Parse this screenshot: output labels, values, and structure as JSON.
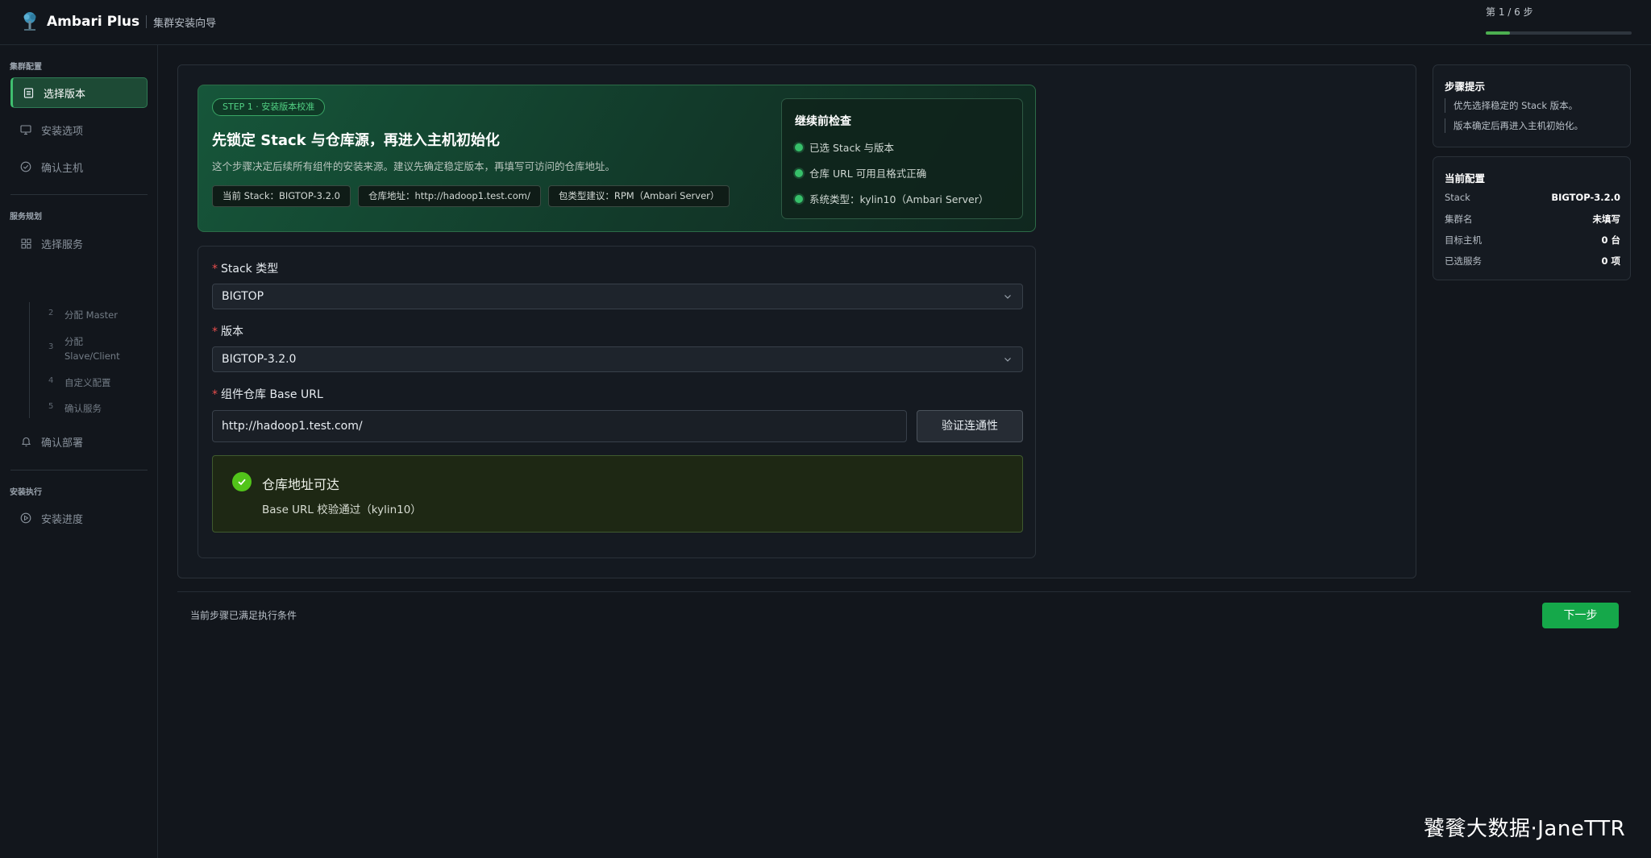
{
  "header": {
    "app_name": "Ambari Plus",
    "subtitle": "集群安装向导",
    "step_text": "第 1 / 6 步",
    "progress_fraction": 0.1667
  },
  "sidebar": {
    "sections": [
      {
        "title": "集群配置"
      },
      {
        "title": "服务规划"
      },
      {
        "title": "安装执行"
      }
    ],
    "items": [
      {
        "label": "选择版本",
        "icon": "list-icon",
        "active": true
      },
      {
        "label": "安装选项",
        "icon": "monitor-icon",
        "active": false
      },
      {
        "label": "确认主机",
        "icon": "check-circle-icon",
        "active": false
      },
      {
        "label": "选择服务",
        "icon": "grid-icon",
        "active": false
      },
      {
        "label": "确认部署",
        "icon": "bell-icon",
        "active": false
      },
      {
        "label": "安装进度",
        "icon": "play-circle-icon",
        "active": false
      }
    ],
    "sub_items": [
      {
        "num": "2",
        "label": "分配 Master"
      },
      {
        "num": "3",
        "label": "分配 Slave/Client"
      },
      {
        "num": "4",
        "label": "自定义配置"
      },
      {
        "num": "5",
        "label": "确认服务"
      }
    ]
  },
  "hero": {
    "badge": "STEP 1 · 安装版本校准",
    "title": "先锁定 Stack 与仓库源，再进入主机初始化",
    "description": "这个步骤决定后续所有组件的安装来源。建议先确定稳定版本，再填写可访问的仓库地址。",
    "chips": [
      "当前 Stack：BIGTOP-3.2.0",
      "仓库地址：http://hadoop1.test.com/",
      "包类型建议：RPM（Ambari Server）"
    ],
    "precheck": {
      "title": "继续前检查",
      "items": [
        "已选 Stack 与版本",
        "仓库 URL 可用且格式正确",
        "系统类型：kylin10（Ambari Server）"
      ]
    }
  },
  "form": {
    "stack_label": "Stack 类型",
    "stack_value": "BIGTOP",
    "version_label": "版本",
    "version_value": "BIGTOP-3.2.0",
    "url_label": "组件仓库 Base URL",
    "url_value": "http://hadoop1.test.com/",
    "verify_label": "验证连通性",
    "success_title": "仓库地址可达",
    "success_desc": "Base URL 校验通过（kylin10）"
  },
  "tips": {
    "title": "步骤提示",
    "items": [
      "优先选择稳定的 Stack 版本。",
      "版本确定后再进入主机初始化。"
    ]
  },
  "config": {
    "title": "当前配置",
    "rows": [
      {
        "key": "Stack",
        "value": "BIGTOP-3.2.0"
      },
      {
        "key": "集群名",
        "value": "未填写"
      },
      {
        "key": "目标主机",
        "value": "0 台"
      },
      {
        "key": "已选服务",
        "value": "0 项"
      }
    ]
  },
  "footer": {
    "status": "当前步骤已满足执行条件",
    "next_label": "下一步"
  },
  "watermark": "饕餮大数据·JaneTTR",
  "colors": {
    "accent": "#15a84a",
    "background": "#12161c",
    "success": "#52c41a"
  }
}
